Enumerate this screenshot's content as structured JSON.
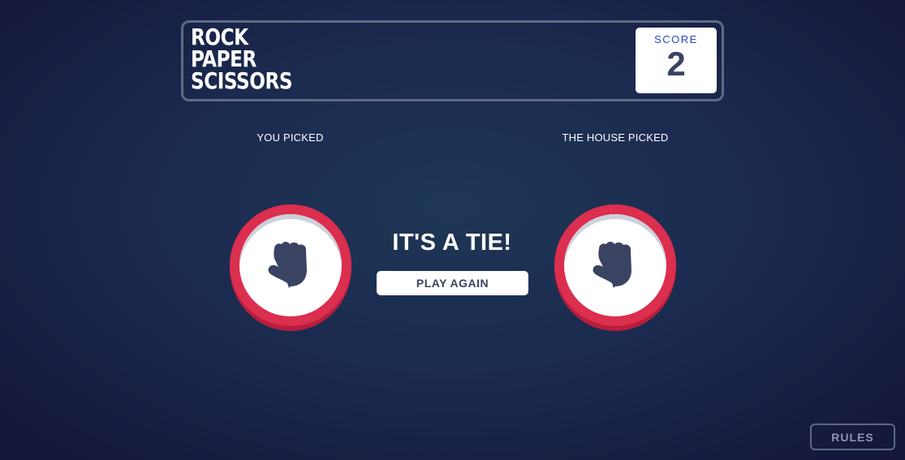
{
  "header": {
    "title_lines": [
      "ROCK",
      "PAPER",
      "SCISSORS"
    ],
    "score_label": "SCORE",
    "score_value": "2"
  },
  "player": {
    "label": "YOU PICKED",
    "choice": "rock",
    "icon": "rock-icon"
  },
  "house": {
    "label": "THE HOUSE PICKED",
    "choice": "rock",
    "icon": "rock-icon"
  },
  "result": {
    "text": "IT'S A TIE!",
    "play_again_label": "PLAY AGAIN"
  },
  "footer": {
    "rules_label": "RULES"
  },
  "colors": {
    "background": "#1f3756",
    "rock_ring": "#dc2e4e",
    "rock_shadow": "#b71e3d",
    "icon": "#3b4363",
    "score_label": "#2a46c0",
    "header_border": "#5d6a82"
  }
}
